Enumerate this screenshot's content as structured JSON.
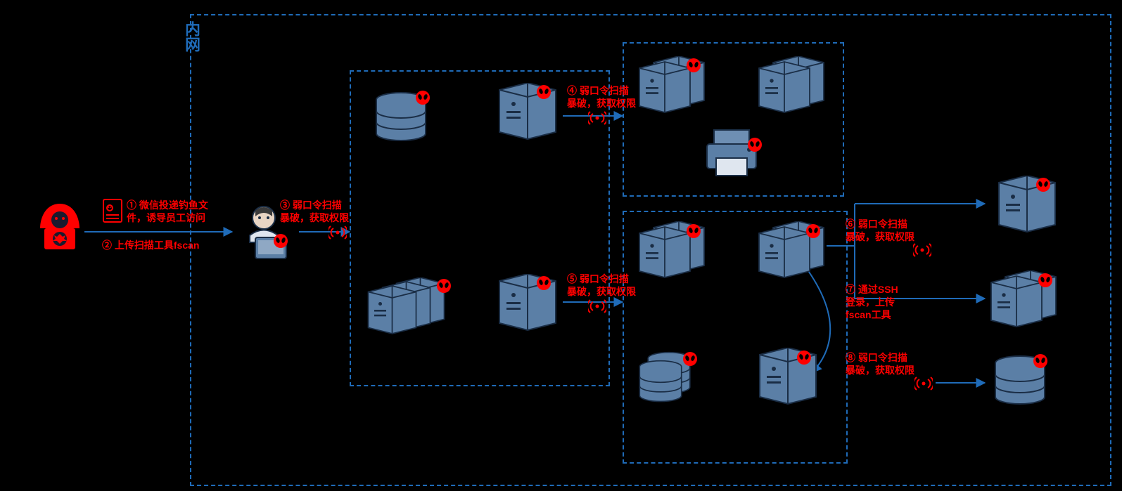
{
  "zone_label": "内网",
  "steps": {
    "s1": "① 微信投递钓鱼文\n件，诱导员工访问",
    "s2": "② 上传扫描工具fscan",
    "s3": "③ 弱口令扫描\n暴破，获取权限",
    "s4": "④ 弱口令扫描\n暴破，获取权限",
    "s5": "⑤ 弱口令扫描\n暴破，获取权限",
    "s6": "⑥ 弱口令扫描\n暴破，获取权限",
    "s7": "⑦ 通过SSH\n登录，上传\nfscan工具",
    "s8": "⑧ 弱口令扫描\n暴破，获取权限"
  },
  "nodes": {
    "attacker": "attacker",
    "phish_doc": "phishing-document",
    "employee": "employee-workstation",
    "db_a": "database-server",
    "srv_a": "server-single",
    "srv_triple": "server-triple",
    "srv_b": "server-single",
    "srv_pair_top1": "server-pair",
    "srv_pair_top2": "server-pair",
    "printer": "printer",
    "srv_pair_mid1": "server-pair",
    "srv_pair_mid2": "server-pair",
    "db_mid": "database-stack",
    "srv_mid_single": "server-single",
    "srv_right1": "server-single",
    "srv_right2": "server-pair",
    "db_right": "database-server"
  }
}
